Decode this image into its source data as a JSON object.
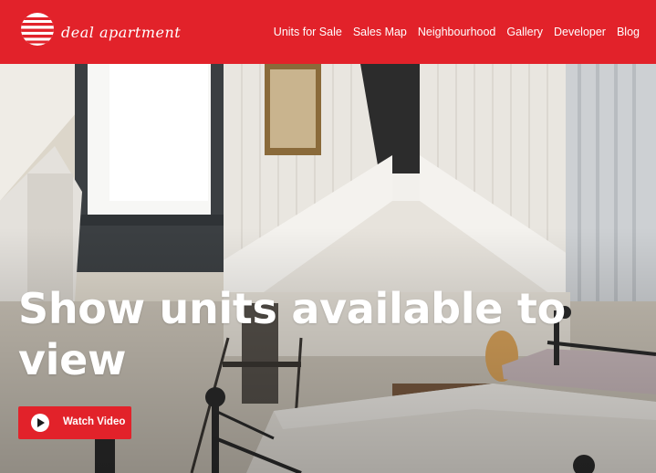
{
  "brand": {
    "name": "deal apartment",
    "logo_icon": "striped-globe-icon"
  },
  "nav": {
    "items": [
      {
        "label": "Units for Sale"
      },
      {
        "label": "Sales Map"
      },
      {
        "label": "Neighbourhood"
      },
      {
        "label": "Gallery"
      },
      {
        "label": "Developer"
      },
      {
        "label": "Blog"
      }
    ]
  },
  "hero": {
    "headline": "Show units available to view",
    "button_label": "Watch Video",
    "button_icon": "play-circle-icon"
  },
  "colors": {
    "brand_red": "#e2222a",
    "text_white": "#ffffff"
  }
}
